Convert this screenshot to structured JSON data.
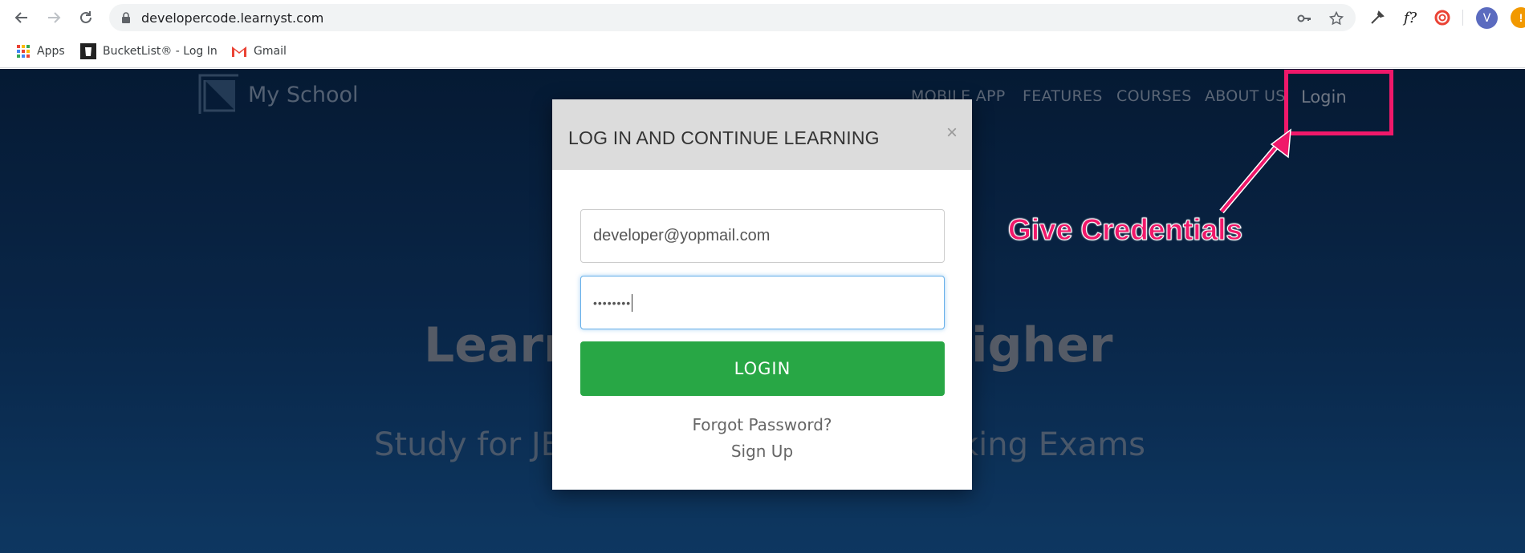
{
  "browser": {
    "url": "developercode.learnyst.com",
    "avatar_initial": "V",
    "update_badge": "!",
    "bookmarks": [
      {
        "label": "Apps",
        "icon": "apps-grid-icon"
      },
      {
        "label": "BucketList® - Log In",
        "icon": "bucketlist-icon"
      },
      {
        "label": "Gmail",
        "icon": "gmail-icon"
      }
    ]
  },
  "site": {
    "brand": "My School",
    "nav": [
      "MOBILE APP",
      "FEATURES",
      "COURSES",
      "ABOUT US"
    ],
    "login": "Login",
    "hero_title_left": "Learn",
    "hero_title_right": "igher",
    "hero_sub_left": "Study for JE",
    "hero_sub_right": "king Exams"
  },
  "modal": {
    "title": "LOG IN AND CONTINUE LEARNING",
    "close": "×",
    "email": "developer@yopmail.com",
    "password": "••••••••",
    "login_button": "LOGIN",
    "forgot": "Forgot Password?",
    "signup": "Sign Up"
  },
  "annotation": {
    "text": "Give Credentials",
    "color": "#f0186a"
  },
  "colors": {
    "login_green": "#28a745",
    "page_bg": "#0c305a"
  }
}
